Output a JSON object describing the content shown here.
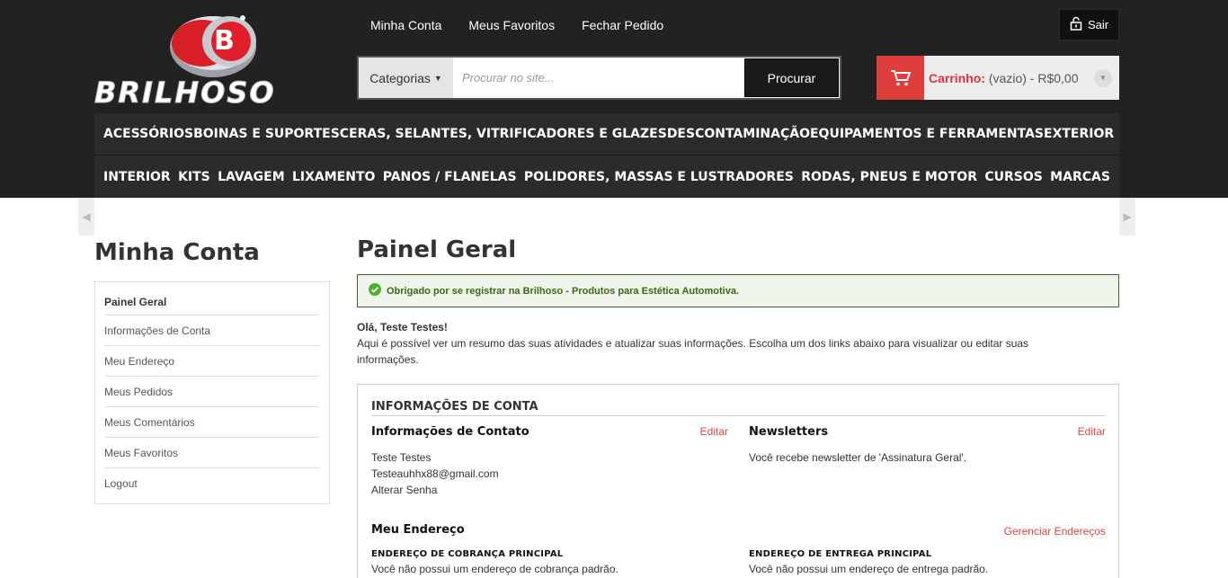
{
  "brand": {
    "logo_text": "BRILHOSO",
    "logo_letter": "B"
  },
  "top_links": [
    "Minha Conta",
    "Meus Favoritos",
    "Fechar Pedido"
  ],
  "logout": {
    "label": "Sair"
  },
  "search": {
    "category": "Categorias",
    "placeholder": "Procurar no site...",
    "button": "Procurar"
  },
  "cart": {
    "label": "Carrinho:",
    "status": "(vazio) - R$0,00"
  },
  "nav": {
    "row1": [
      "ACESSÓRIOS",
      "BOINAS E SUPORTES",
      "CERAS, SELANTES, VITRIFICADORES E GLAZES",
      "DESCONTAMINAÇÃO",
      "EQUIPAMENTOS E FERRAMENTAS",
      "EXTERIOR"
    ],
    "row2": [
      "INTERIOR",
      "KITS",
      "LAVAGEM",
      "LIXAMENTO",
      "PANOS / FLANELAS",
      "POLIDORES, MASSAS E LUSTRADORES",
      "RODAS, PNEUS E MOTOR",
      "CURSOS",
      "MARCAS"
    ]
  },
  "sidebar": {
    "title": "Minha Conta",
    "items": [
      "Painel Geral",
      "Informações de Conta",
      "Meu Endereço",
      "Meus Pedidos",
      "Meus Comentários",
      "Meus Favoritos",
      "Logout"
    ]
  },
  "main": {
    "title": "Painel Geral",
    "success": "Obrigado por se registrar na Brilhoso - Produtos para Estética Automotiva.",
    "hello": "Olá, Teste Testes!",
    "intro": "Aqui é possível ver um resumo das suas atividades e atualizar suas informações. Escolha um dos links abaixo para visualizar ou editar suas informações."
  },
  "account": {
    "title": "INFORMAÇÕES DE CONTA",
    "contact": {
      "heading": "Informações de Contato",
      "edit": "Editar",
      "name": "Teste Testes",
      "email": "Testeauhhx88@gmail.com",
      "change_password": "Alterar Senha"
    },
    "newsletter": {
      "heading": "Newsletters",
      "edit": "Editar",
      "text": "Você recebe newsletter de 'Assinatura Geral'."
    },
    "address": {
      "heading": "Meu Endereço",
      "manage": "Gerenciar Endereços",
      "billing_heading": "ENDEREÇO DE COBRANÇA PRINCIPAL",
      "billing_text": "Você não possui um endereço de cobrança padrão.",
      "shipping_heading": "ENDEREÇO DE ENTREGA PRINCIPAL",
      "shipping_text": "Você não possui um endereço de entrega padrão."
    }
  },
  "colors": {
    "header_bg": "#222222",
    "accent_red": "#e03d3d",
    "success_green": "#3d6611"
  }
}
